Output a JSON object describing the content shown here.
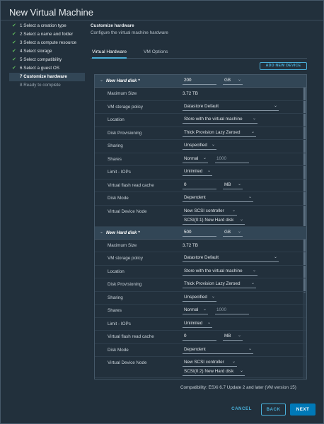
{
  "window": {
    "title": "New Virtual Machine"
  },
  "steps": [
    {
      "label": "1 Select a creation type",
      "state": "done"
    },
    {
      "label": "2 Select a name and folder",
      "state": "done"
    },
    {
      "label": "3 Select a compute resource",
      "state": "done"
    },
    {
      "label": "4 Select storage",
      "state": "done"
    },
    {
      "label": "5 Select compatibility",
      "state": "done"
    },
    {
      "label": "6 Select a guest OS",
      "state": "done"
    },
    {
      "label": "7 Customize hardware",
      "state": "active"
    },
    {
      "label": "8 Ready to complete",
      "state": "pending"
    }
  ],
  "header": {
    "title": "Customize hardware",
    "description": "Configure the virtual machine hardware"
  },
  "tabs": [
    {
      "label": "Virtual Hardware",
      "active": true
    },
    {
      "label": "VM Options",
      "active": false
    }
  ],
  "add_device_label": "ADD NEW DEVICE",
  "disks": [
    {
      "name": "New Hard disk *",
      "size": "200",
      "size_unit": "GB",
      "max_size_label": "Maximum Size",
      "max_size": "3.72 TB",
      "policy_label": "VM storage policy",
      "policy": "Datastore Default",
      "location_label": "Location",
      "location": "Store with the virtual machine",
      "provisioning_label": "Disk Provisioning",
      "provisioning": "Thick Provision Lazy Zeroed",
      "sharing_label": "Sharing",
      "sharing": "Unspecified",
      "shares_label": "Shares",
      "shares_level": "Normal",
      "shares_value": "1000",
      "iops_label": "Limit - IOPs",
      "iops": "Unlimited",
      "cache_label": "Virtual flash read cache",
      "cache": "0",
      "cache_unit": "MB",
      "mode_label": "Disk Mode",
      "mode": "Dependent",
      "node_label": "Virtual Device Node",
      "controller": "New SCSI controller",
      "node": "SCSI(0:1) New Hard disk"
    },
    {
      "name": "New Hard disk *",
      "size": "500",
      "size_unit": "GB",
      "max_size_label": "Maximum Size",
      "max_size": "3.72 TB",
      "policy_label": "VM storage policy",
      "policy": "Datastore Default",
      "location_label": "Location",
      "location": "Store with the virtual machine",
      "provisioning_label": "Disk Provisioning",
      "provisioning": "Thick Provision Lazy Zeroed",
      "sharing_label": "Sharing",
      "sharing": "Unspecified",
      "shares_label": "Shares",
      "shares_level": "Normal",
      "shares_value": "1000",
      "iops_label": "Limit - IOPs",
      "iops": "Unlimited",
      "cache_label": "Virtual flash read cache",
      "cache": "0",
      "cache_unit": "MB",
      "mode_label": "Disk Mode",
      "mode": "Dependent",
      "node_label": "Virtual Device Node",
      "controller": "New SCSI controller",
      "node": "SCSI(0:2) New Hard disk"
    }
  ],
  "compatibility": "Compatibility: ESXi 6.7 Update 2 and later (VM version 15)",
  "buttons": {
    "cancel": "CANCEL",
    "back": "BACK",
    "next": "NEXT"
  },
  "colors": {
    "accent": "#49afd9",
    "primary": "#0079b8",
    "check": "#5fb85b",
    "background": "#22303c"
  }
}
